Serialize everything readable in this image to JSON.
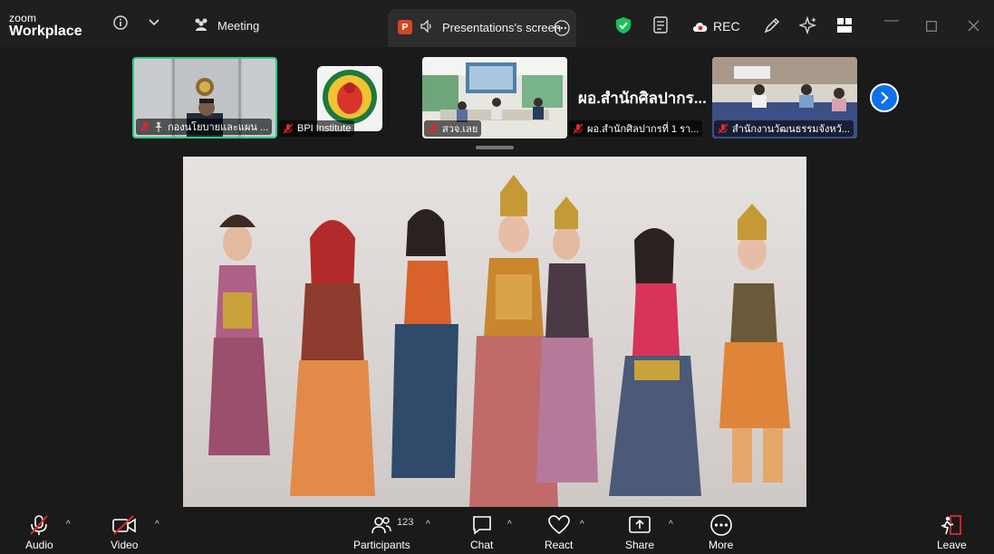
{
  "app": {
    "logo_line1": "zoom",
    "logo_line2": "Workplace"
  },
  "titlebar": {
    "meeting_label": "Meeting",
    "presentation_tab_label": "Presentations's screen",
    "presentation_badge": "P",
    "rec_label": "REC"
  },
  "participants_strip": [
    {
      "name": "กองนโยบายและแผน ...",
      "muted": true,
      "active": true
    },
    {
      "name": "BPI Institute",
      "muted": true
    },
    {
      "name": "สวจ.เลย",
      "muted": true
    },
    {
      "name": "ผอ.สำนักศิลปากรที่ 1 รา...",
      "big_name": "ผอ.สำนักศิลปากร...",
      "muted": true
    },
    {
      "name": "สำนักงานวัฒนธรรมจังหวั...",
      "muted": true
    }
  ],
  "toolbar": {
    "audio": "Audio",
    "video": "Video",
    "participants": "Participants",
    "participants_count": "123",
    "chat": "Chat",
    "react": "React",
    "share": "Share",
    "more": "More",
    "leave": "Leave"
  },
  "colors": {
    "active_speaker_border": "#26d07c",
    "accent_blue": "#0e71eb",
    "mute_red": "#e02828",
    "shield_green": "#19c25a",
    "leave_red": "#e02828"
  }
}
